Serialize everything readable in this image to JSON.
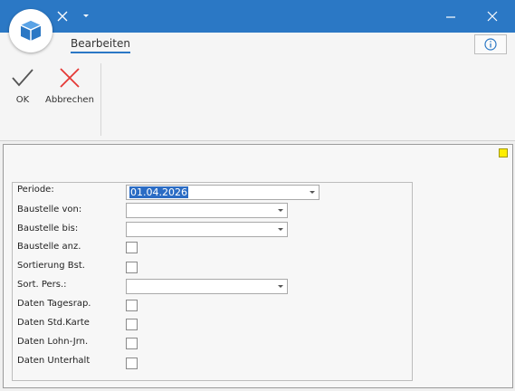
{
  "titlebar": {
    "qat_icons": [
      "close-x-icon",
      "dropdown-arrow-icon"
    ],
    "window_controls": [
      "minimize-icon",
      "close-icon"
    ],
    "background": "#2b78c5"
  },
  "ribbon": {
    "tab_label": "Bearbeiten",
    "ok_label": "OK",
    "cancel_label": "Abbrechen",
    "info_icon": "info-icon"
  },
  "form": {
    "periode": {
      "label": "Periode:",
      "value": "01.04.2026"
    },
    "baustelle_von": {
      "label": "Baustelle von:",
      "value": ""
    },
    "baustelle_bis": {
      "label": "Baustelle bis:",
      "value": ""
    },
    "baustelle_anz": {
      "label": "Baustelle anz.",
      "checked": false
    },
    "sortierung_bst": {
      "label": "Sortierung Bst.",
      "checked": false
    },
    "sort_pers": {
      "label": "Sort. Pers.:",
      "value": ""
    },
    "daten_tagesrap": {
      "label": "Daten Tagesrap.",
      "checked": false
    },
    "daten_std_karte": {
      "label": "Daten Std.Karte",
      "checked": false
    },
    "daten_lohn_jrn": {
      "label": "Daten Lohn-Jrn.",
      "checked": false
    },
    "daten_unterhalt": {
      "label": "Daten Unterhalt",
      "checked": false
    }
  },
  "colors": {
    "accent": "#2b78c5",
    "ok_check": "#555555",
    "cancel_x": "#e53935",
    "marker": "#ffee00"
  }
}
